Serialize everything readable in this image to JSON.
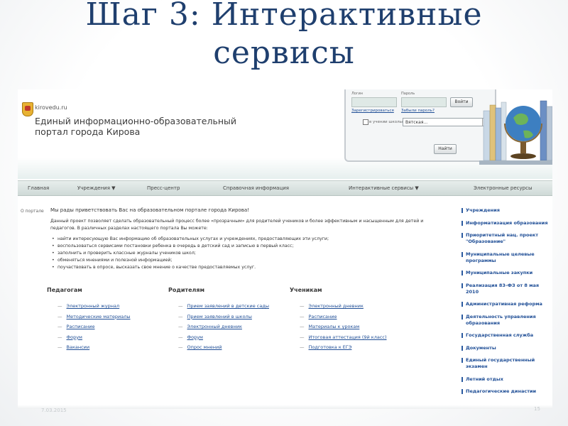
{
  "slide": {
    "title_line1": "Шаг 3: Интерактивные",
    "title_line2": "сервисы",
    "ghost_left": "7.03.2015",
    "ghost_right": "15"
  },
  "site": {
    "domain": "kirovedu.ru",
    "title_line1": "Единый информационно-образовательный",
    "title_line2": "портал города Кирова"
  },
  "login": {
    "login_label": "Логин",
    "password_label": "Пароль",
    "login_button": "Войти",
    "register_link": "Зарегистрироваться",
    "forgot_link": "Забыли пароль?",
    "school_label": "в учении школы",
    "school_value": "Вятская...",
    "find_button": "Найти"
  },
  "nav": {
    "items": [
      "Главная",
      "Учреждения ▼",
      "Пресс-центр",
      "Справочная информация",
      "Интерактивные сервисы ▼",
      "Электронные ресурсы"
    ]
  },
  "content": {
    "breadcrumb": "О портале",
    "welcome": "Мы рады приветствовать Вас на образовательном портале города Кирова!",
    "intro": "Данный проект позволяет сделать образовательный процесс более «прозрачным» для родителей учеников и более эффективным и насыщенным для детей и педагогов. В различных разделах настоящего портала Вы можете:",
    "bullets": [
      "найти интересующую Вас информацию об образовательных услугах и учреждениях, предоставляющих эти услуги;",
      "воспользоваться сервисами постановки ребенка в очередь в детский сад и записью в первый класс;",
      "заполнить и проверить классные журналы учеников школ;",
      "обменяться мнениями и полезной информацией;",
      "поучаствовать в опросе, высказать свое мнение о качестве предоставляемых услуг."
    ],
    "columns": [
      {
        "heading": "Педагогам",
        "links": [
          "Электронный журнал",
          "Методические материалы",
          "Расписание",
          "Форум",
          "Вакансии"
        ]
      },
      {
        "heading": "Родителям",
        "links": [
          "Прием заявлений в детские сады",
          "Прием заявлений в школы",
          "Электронный дневник",
          "Форум",
          "Опрос мнений"
        ]
      },
      {
        "heading": "Ученикам",
        "links": [
          "Электронный дневник",
          "Расписание",
          "Материалы к урокам",
          "Итоговая аттестация (9й класс)",
          "Подготовка к ЕГЭ"
        ]
      }
    ]
  },
  "sidebar": {
    "items": [
      "Учреждения",
      "Информатизация образования",
      "Приоритетный нац. проект \"Образование\"",
      "Муниципальные целевые программы",
      "Муниципальные закупки",
      "Реализация 83-ФЗ от 8 мая 2010",
      "Административная реформа",
      "Деятельность управления образования",
      "Государственная служба",
      "Документы",
      "Единый государственный экзамен",
      "Летний отдых",
      "Педагогические династии"
    ]
  },
  "colors": {
    "slide_title": "#1f3f6e",
    "link": "#1f4e96",
    "nav_bg": "#dbe4e2",
    "input_bg": "#dfe9e6"
  }
}
